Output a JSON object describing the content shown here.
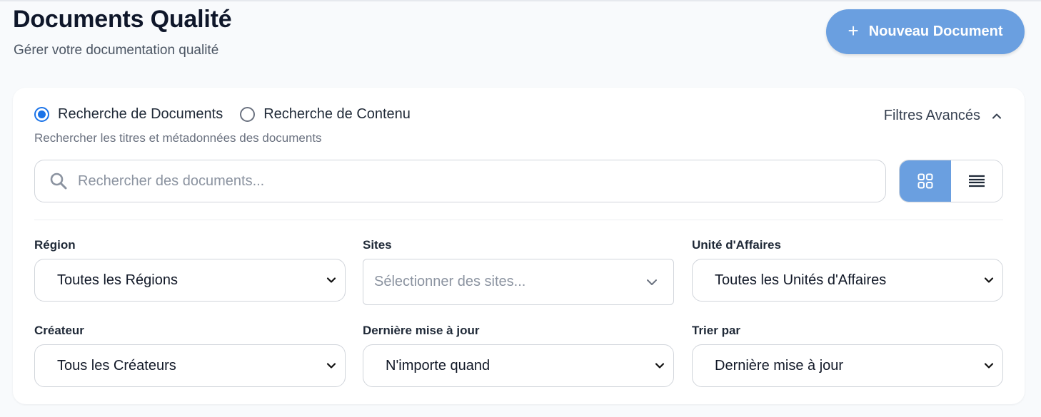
{
  "header": {
    "title": "Documents Qualité",
    "subtitle": "Gérer votre documentation qualité",
    "new_button_label": "Nouveau Document",
    "new_button_icon": "plus-icon"
  },
  "search_mode": {
    "options": [
      {
        "label": "Recherche de Documents",
        "selected": true
      },
      {
        "label": "Recherche de Contenu",
        "selected": false
      }
    ],
    "hint": "Rechercher les titres et métadonnées des documents"
  },
  "advanced_filters": {
    "label": "Filtres Avancés",
    "expanded": true,
    "icon": "chevron-up-icon"
  },
  "search": {
    "placeholder": "Rechercher des documents...",
    "value": "",
    "icon": "search-icon"
  },
  "view_toggle": {
    "options": [
      "grid-icon",
      "list-icon"
    ],
    "active": "grid"
  },
  "filters": {
    "region": {
      "label": "Région",
      "value": "Toutes les Régions"
    },
    "sites": {
      "label": "Sites",
      "placeholder": "Sélectionner des sites..."
    },
    "business_unit": {
      "label": "Unité d'Affaires",
      "value": "Toutes les Unités d'Affaires"
    },
    "creator": {
      "label": "Créateur",
      "value": "Tous les Créateurs"
    },
    "last_update": {
      "label": "Dernière mise à jour",
      "value": "N'importe quand"
    },
    "sort_by": {
      "label": "Trier par",
      "value": "Dernière mise à jour"
    }
  },
  "colors": {
    "accent": "#6a9fe0",
    "radio_selected": "#1a73e8",
    "background": "#f8fafc"
  }
}
